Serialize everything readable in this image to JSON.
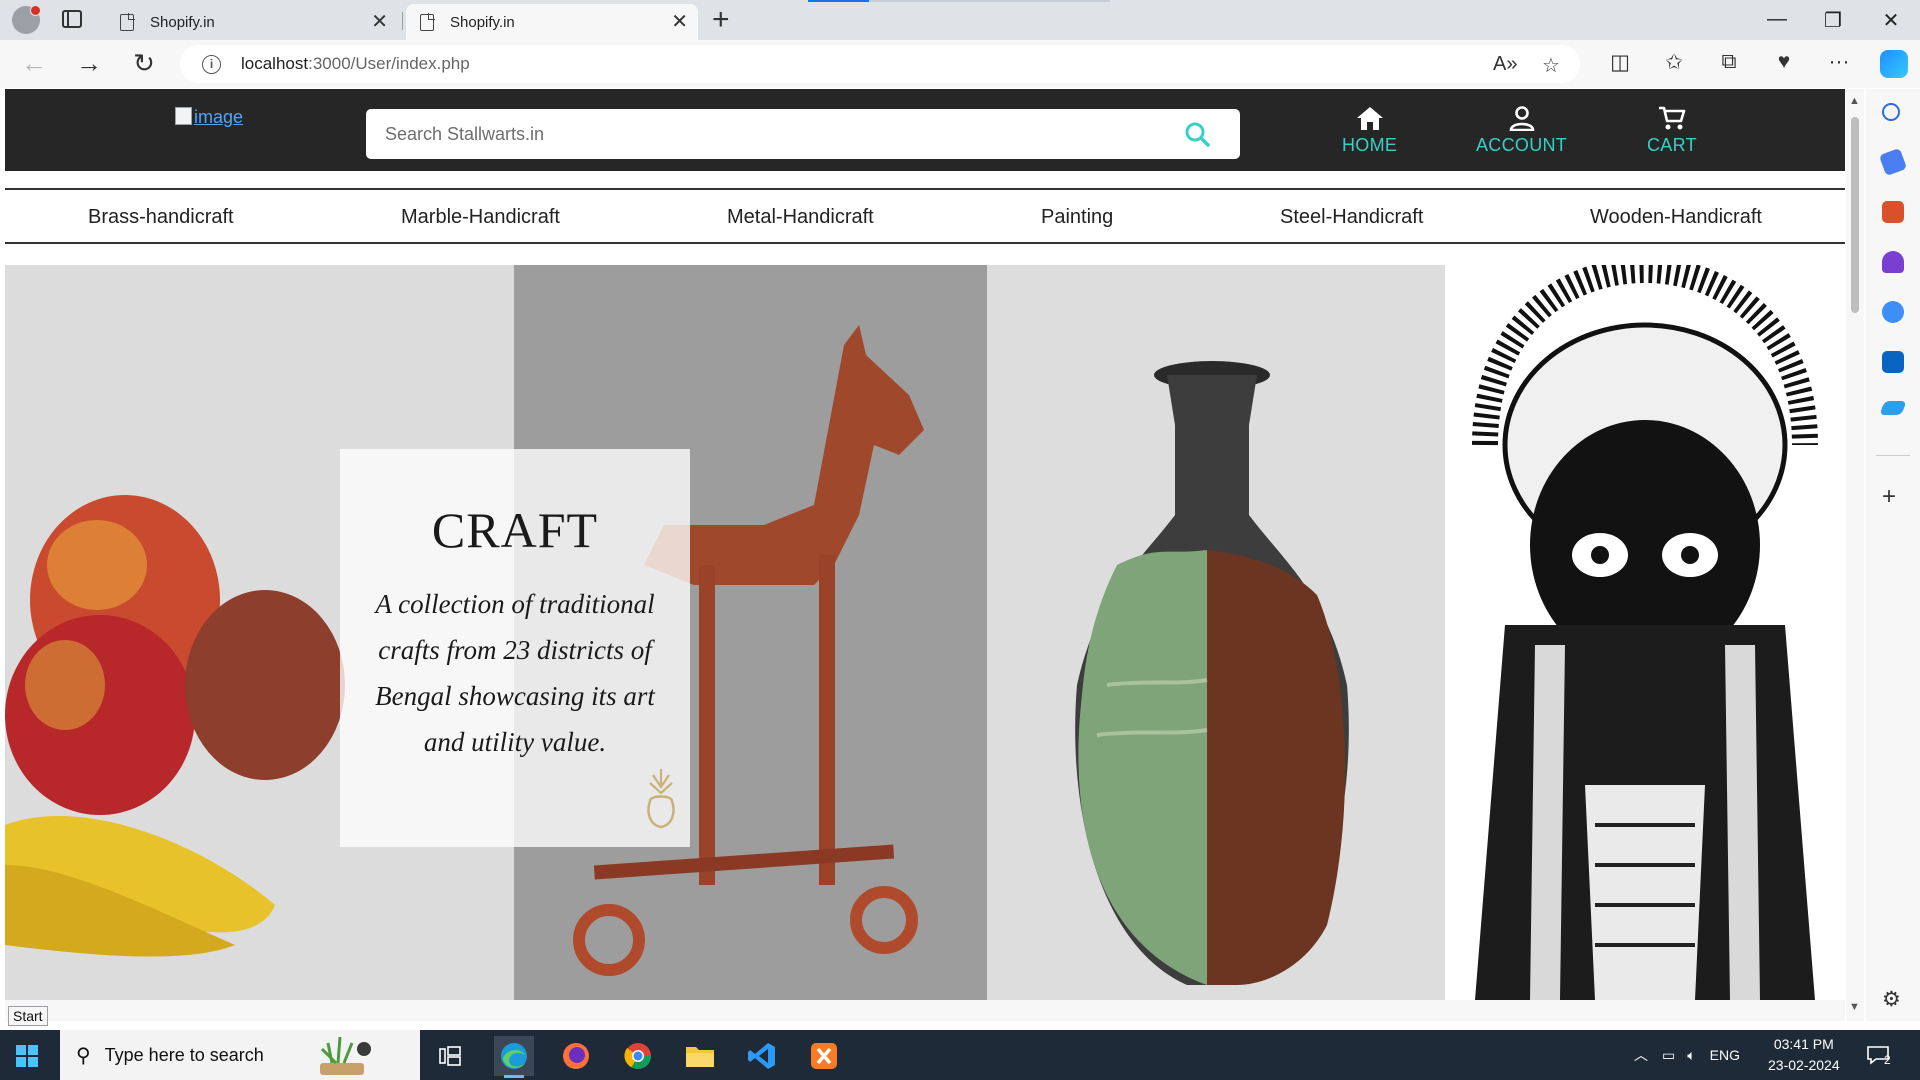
{
  "browser": {
    "tabs": [
      {
        "title": "Shopify.in",
        "active": false
      },
      {
        "title": "Shopify.in",
        "active": true
      }
    ],
    "url_host": "localhost",
    "url_path": ":3000/User/index.php",
    "status_tooltip": "Start"
  },
  "site": {
    "logo_alt": "image",
    "search_placeholder": "Search Stallwarts.in",
    "nav": [
      {
        "label": "HOME",
        "icon": "home-icon"
      },
      {
        "label": "ACCOUNT",
        "icon": "person-icon"
      },
      {
        "label": "CART",
        "icon": "cart-icon"
      }
    ],
    "categories": [
      "Brass-handicraft",
      "Marble-Handicraft",
      "Metal-Handicraft",
      "Painting",
      "Steel-Handicraft",
      "Wooden-Handicraft"
    ],
    "accent_color": "#36d0c6",
    "header_color": "#262626"
  },
  "carousel": {
    "card_title": "CRAFT",
    "card_text": "A collection of traditional crafts from 23 districts of Bengal showcasing its art and utility value.",
    "slide_count": 5,
    "active_slide": 1
  },
  "taskbar": {
    "search_placeholder": "Type here to search",
    "lang": "ENG",
    "time": "03:41 PM",
    "date": "23-02-2024",
    "notification_count": "2"
  }
}
